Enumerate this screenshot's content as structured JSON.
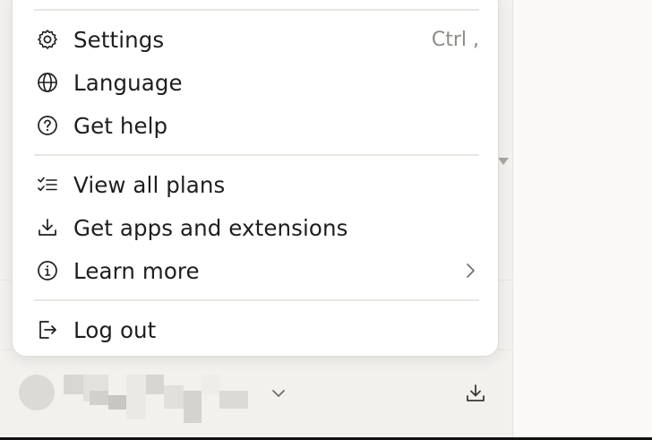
{
  "menu": {
    "items": [
      {
        "label": "Settings",
        "icon": "gear-icon",
        "shortcut": "Ctrl ,"
      },
      {
        "label": "Language",
        "icon": "globe-icon"
      },
      {
        "label": "Get help",
        "icon": "help-circle-icon"
      },
      {
        "label": "View all plans",
        "icon": "checklist-icon"
      },
      {
        "label": "Get apps and extensions",
        "icon": "download-icon"
      },
      {
        "label": "Learn more",
        "icon": "info-icon",
        "submenu_icon": "chevron-right-icon"
      },
      {
        "label": "Log out",
        "icon": "logout-icon"
      }
    ]
  },
  "account": {
    "name_blurred": true,
    "dropdown_icon": "chevron-down-icon",
    "action_icon": "download-icon"
  },
  "colors": {
    "text": "#1f1e1c",
    "muted": "#8e8c87",
    "menu_bg": "#ffffff",
    "sidebar_bg": "#f2f1ee"
  }
}
